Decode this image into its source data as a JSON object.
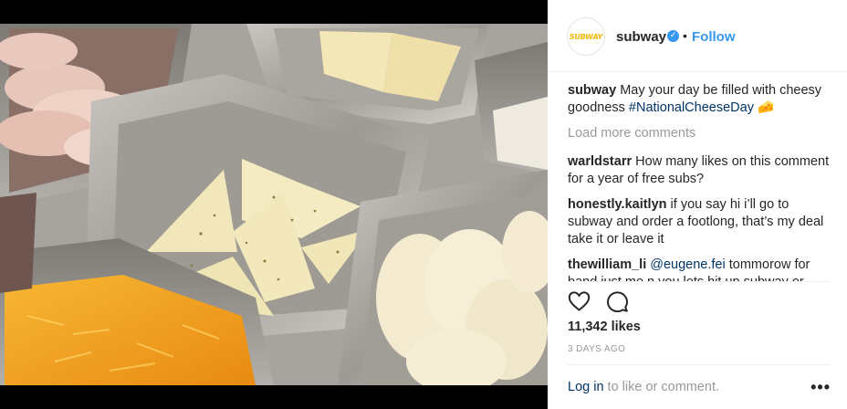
{
  "post": {
    "brand_logo_text": "SUBWAY",
    "username": "subway",
    "verified_mark": "✓",
    "separator": "•",
    "follow_label": "Follow"
  },
  "caption": {
    "username": "subway",
    "text": "May your day be filled with cheesy goodness",
    "hashtag": "#NationalCheeseDay",
    "emoji": "🧀"
  },
  "load_more_label": "Load more comments",
  "comments": [
    {
      "username": "warldstarr",
      "text": "How many likes on this comment for a year of free subs?"
    },
    {
      "username": "honestly.kaitlyn",
      "text": "if you say hi i’ll go to subway and order a footlong, that’s my deal take it or leave it"
    },
    {
      "username": "thewilliam_li",
      "mention": "@eugene.fei",
      "text": "tommorow for band just me n you lets hit up subway or cockney kings lets just hang im not going"
    }
  ],
  "likes_text": "11,342 likes",
  "date_text": "3 DAYS AGO",
  "login": {
    "link": "Log in",
    "rest": "to like or comment."
  },
  "more_label": "•••",
  "icons": {
    "like": "heart-icon",
    "comment": "comment-icon",
    "more": "more-options-icon",
    "verified": "verified-badge-icon"
  },
  "colors": {
    "link_blue": "#3897f0",
    "dark_link": "#003569",
    "muted": "#999999",
    "text": "#262626"
  }
}
